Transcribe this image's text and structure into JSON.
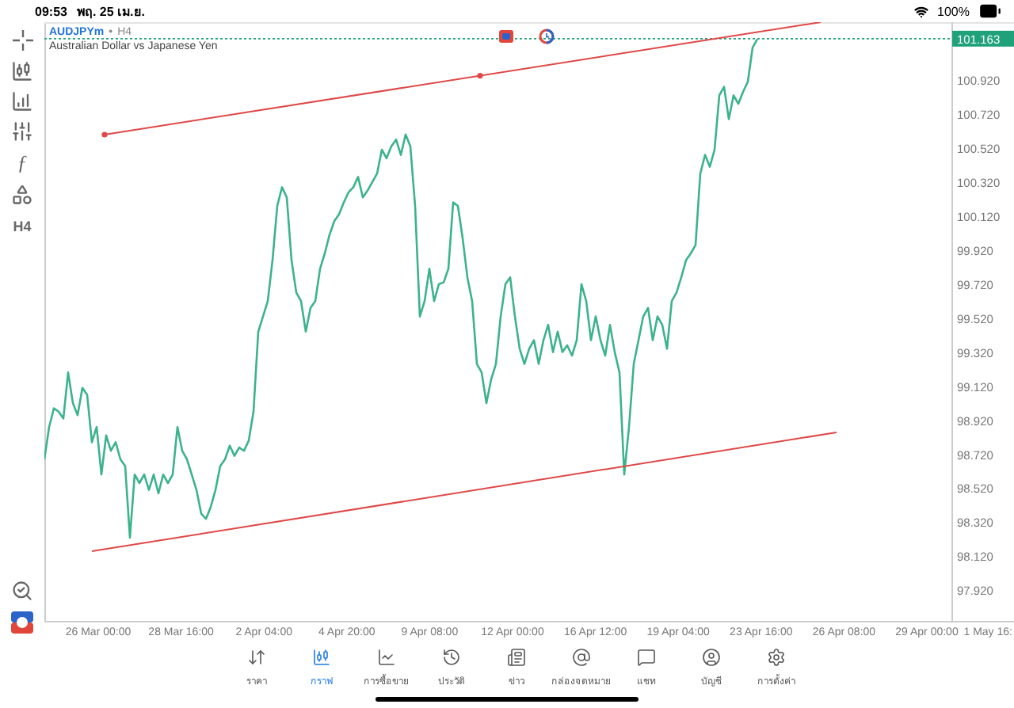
{
  "status_bar": {
    "time": "09:53",
    "date": "พฤ. 25 เม.ย.",
    "battery": "100%"
  },
  "toolbar": {
    "function_symbol": "ƒ",
    "timeframe": "H4"
  },
  "chart": {
    "separator": "•",
    "timeframe": "H4",
    "description": "Australian Dollar vs Japanese Yen",
    "chart_data": {
      "type": "line",
      "series": [
        {
          "name": "AUDJPYm",
          "color": "#3cb38a",
          "values": [
            98.69,
            98.88,
            98.99,
            98.97,
            98.93,
            99.2,
            99.02,
            98.95,
            99.11,
            99.07,
            98.79,
            98.88,
            98.6,
            98.83,
            98.74,
            98.79,
            98.69,
            98.65,
            98.23,
            98.6,
            98.55,
            98.6,
            98.51,
            98.6,
            98.49,
            98.6,
            98.55,
            98.6,
            98.88,
            98.74,
            98.69,
            98.6,
            98.51,
            98.37,
            98.34,
            98.41,
            98.51,
            98.65,
            98.69,
            98.77,
            98.71,
            98.76,
            98.74,
            98.8,
            98.97,
            99.44,
            99.53,
            99.62,
            99.86,
            100.18,
            100.29,
            100.23,
            99.86,
            99.67,
            99.62,
            99.44,
            99.58,
            99.62,
            99.81,
            99.9,
            100.01,
            100.09,
            100.13,
            100.2,
            100.26,
            100.29,
            100.35,
            100.23,
            100.27,
            100.32,
            100.37,
            100.51,
            100.46,
            100.53,
            100.57,
            100.48,
            100.6,
            100.53,
            100.18,
            99.53,
            99.62,
            99.81,
            99.62,
            99.72,
            99.73,
            99.81,
            100.2,
            100.18,
            99.99,
            99.76,
            99.62,
            99.25,
            99.2,
            99.02,
            99.16,
            99.25,
            99.53,
            99.72,
            99.76,
            99.53,
            99.34,
            99.25,
            99.34,
            99.39,
            99.25,
            99.39,
            99.48,
            99.32,
            99.44,
            99.32,
            99.36,
            99.3,
            99.39,
            99.72,
            99.62,
            99.39,
            99.53,
            99.39,
            99.3,
            99.48,
            99.32,
            99.2,
            98.6,
            98.88,
            99.25,
            99.39,
            99.53,
            99.58,
            99.39,
            99.53,
            99.48,
            99.34,
            99.62,
            99.67,
            99.76,
            99.86,
            99.9,
            99.95,
            100.37,
            100.48,
            100.41,
            100.51,
            100.83,
            100.88,
            100.69,
            100.83,
            100.78,
            100.85,
            100.91,
            101.11,
            101.16
          ]
        }
      ],
      "ylim": [
        97.74,
        101.26
      ],
      "yticks": [
        {
          "value": 100.92,
          "label": "100.920"
        },
        {
          "value": 100.72,
          "label": "100.720"
        },
        {
          "value": 100.52,
          "label": "100.520"
        },
        {
          "value": 100.32,
          "label": "100.320"
        },
        {
          "value": 100.12,
          "label": "100.120"
        },
        {
          "value": 99.92,
          "label": "99.920"
        },
        {
          "value": 99.72,
          "label": "99.720"
        },
        {
          "value": 99.52,
          "label": "99.520"
        },
        {
          "value": 99.32,
          "label": "99.320"
        },
        {
          "value": 99.12,
          "label": "99.120"
        },
        {
          "value": 98.92,
          "label": "98.920"
        },
        {
          "value": 98.72,
          "label": "98.720"
        },
        {
          "value": 98.52,
          "label": "98.520"
        },
        {
          "value": 98.32,
          "label": "98.320"
        },
        {
          "value": 98.12,
          "label": "98.120"
        },
        {
          "value": 97.92,
          "label": "97.920"
        }
      ],
      "ref_lines": [
        {
          "axis": "y",
          "value": 101.163,
          "label": "101.163"
        }
      ]
    },
    "time_axis": [
      "26 Mar 00:00",
      "28 Mar 16:00",
      "2 Apr 04:00",
      "4 Apr 20:00",
      "9 Apr 08:00",
      "12 Apr 00:00",
      "16 Apr 12:00",
      "19 Apr 04:00",
      "23 Apr 16:00",
      "26 Apr 08:00",
      "29 Apr 00:00",
      "1 May 16:"
    ]
  },
  "tabs": [
    {
      "label": "ราคา",
      "selected": false
    },
    {
      "label": "กราฟ",
      "selected": true
    },
    {
      "label": "การซื้อขาย",
      "selected": false
    },
    {
      "label": "ประวัติ",
      "selected": false
    },
    {
      "label": "ข่าว",
      "selected": false
    },
    {
      "label": "กล่องจดหมาย",
      "selected": false
    },
    {
      "label": "แชท",
      "selected": false
    },
    {
      "label": "บัญชี",
      "selected": false
    },
    {
      "label": "การตั้งค่า",
      "selected": false
    }
  ]
}
